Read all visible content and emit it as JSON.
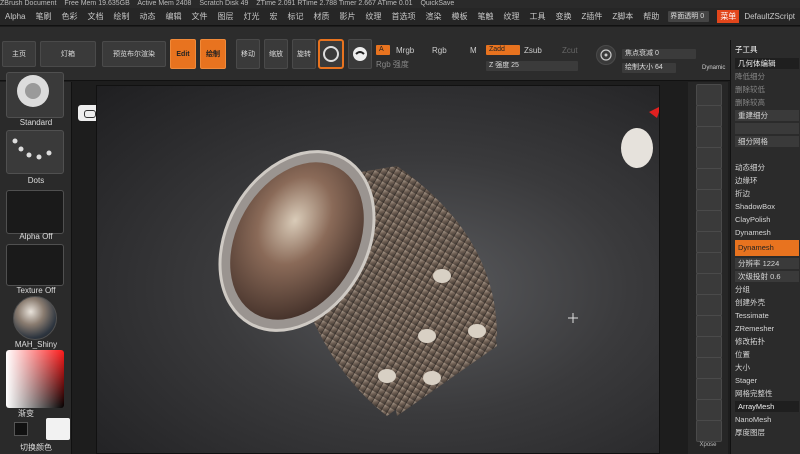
{
  "titlebar": {
    "app": "ZBrush Document",
    "free_mem": "Free Mem 19.635GB",
    "active_mem": "Active Mem 2408",
    "scratch_disk": "Scratch Disk 49",
    "ztime": "ZTime 2.091 RTime 2.788 Timer 2.667 ATime 0.01",
    "quicksave": "QuickSave",
    "transparency": "界面透明 0",
    "menu": "菜单",
    "script": "DefaultZScript"
  },
  "menubar": [
    "Alpha",
    "笔刷",
    "色彩",
    "文档",
    "绘制",
    "动态",
    "编辑",
    "文件",
    "图层",
    "灯光",
    "宏",
    "标记",
    "材质",
    "影片",
    "纹理",
    "首选项",
    "渲染",
    "模板",
    "笔触",
    "纹理",
    "工具",
    "变换",
    "Z插件",
    "Z脚本",
    "帮助"
  ],
  "toolbar": {
    "home": "主页",
    "lightbox": "灯箱",
    "preview": "预览布尔渲染",
    "edit": "Edit",
    "draw": "绘制",
    "move": "移动",
    "scale": "缩放",
    "rotate": "旋转",
    "a": "A",
    "mrgb": "Mrgb",
    "rgb": "Rgb",
    "m": "M",
    "zadd": "Zadd",
    "zsub": "Zsub",
    "zcut": "Zcut",
    "rgb_intensity": "Rgb 强度",
    "z_intensity": "Z 强度 25",
    "focal_shift": "焦点衰减 0",
    "draw_size": "绘制大小 64",
    "dynamic": "Dynamic"
  },
  "leftpanel": {
    "brush": "Standard",
    "stroke": "Dots",
    "alpha": "Alpha Off",
    "texture": "Texture Off",
    "material": "MAH_Shiny",
    "gradient": "渐变",
    "switch_color": "切换颜色"
  },
  "rightshelf": [
    "子选择",
    "移动",
    "缩放",
    "旋转",
    "透视",
    "楼层",
    "局部",
    "XYZ",
    "框架",
    "移动",
    "缩放",
    "旋转",
    "PolyF",
    "透明",
    "Ghost",
    "单独",
    "Xpose"
  ],
  "rightpanel": {
    "title": "子工具",
    "items": [
      {
        "label": "几何体编辑",
        "style": "head"
      },
      {
        "label": "降低细分",
        "style": "dim"
      },
      {
        "label": "删除较低",
        "style": "dim"
      },
      {
        "label": "删除较高",
        "style": "dim"
      },
      {
        "label": "重建细分",
        "style": "box"
      },
      {
        "label": "",
        "style": "box"
      },
      {
        "label": "细分网格",
        "style": "box"
      },
      {
        "label": "",
        "style": ""
      },
      {
        "label": "动态细分",
        "style": ""
      },
      {
        "label": "边缘环",
        "style": ""
      },
      {
        "label": "折边",
        "style": ""
      },
      {
        "label": "ShadowBox",
        "style": ""
      },
      {
        "label": "ClayPolish",
        "style": ""
      },
      {
        "label": "Dynamesh",
        "style": ""
      },
      {
        "label": "Dynamesh",
        "style": "orange"
      },
      {
        "label": "分辨率 1224",
        "style": "box"
      },
      {
        "label": "次级投射 0.6",
        "style": "box"
      },
      {
        "label": "分组",
        "style": ""
      },
      {
        "label": "创建外壳",
        "style": ""
      },
      {
        "label": "Tessimate",
        "style": ""
      },
      {
        "label": "ZRemesher",
        "style": ""
      },
      {
        "label": "修改拓扑",
        "style": ""
      },
      {
        "label": "位置",
        "style": ""
      },
      {
        "label": "大小",
        "style": ""
      },
      {
        "label": "Stager",
        "style": ""
      },
      {
        "label": "网格完整性",
        "style": ""
      },
      {
        "label": "ArrayMesh",
        "style": "head"
      },
      {
        "label": "NanoMesh",
        "style": ""
      },
      {
        "label": "厚度图层",
        "style": ""
      }
    ]
  }
}
